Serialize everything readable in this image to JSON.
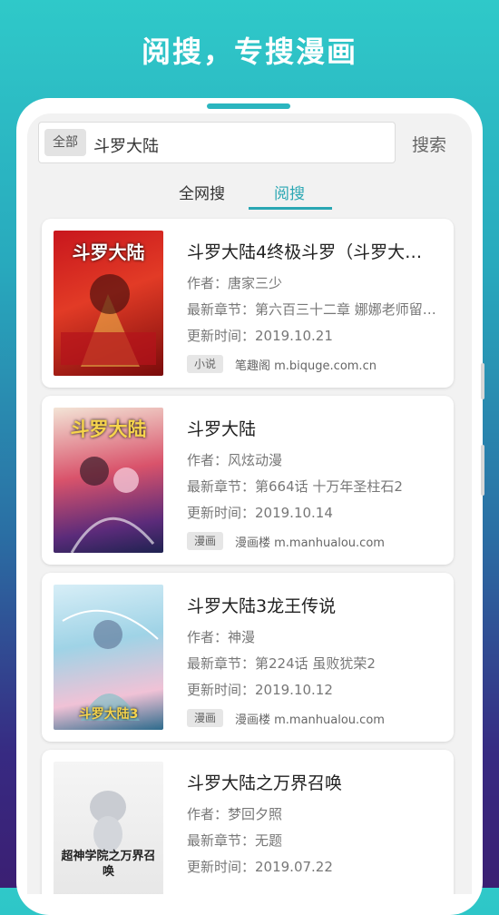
{
  "headline": "阅搜，专搜漫画",
  "search": {
    "scope_label": "全部",
    "query": "斗罗大陆",
    "button_label": "搜索"
  },
  "tabs": [
    {
      "label": "全网搜",
      "active": false
    },
    {
      "label": "阅搜",
      "active": true
    }
  ],
  "results": [
    {
      "title": "斗罗大陆4终极斗罗（斗罗大…",
      "author": "作者：唐家三少",
      "latest": "最新章节：第六百三十二章 娜娜老师留…",
      "updated": "更新时间：2019.10.21",
      "type": "小说",
      "source": "笔趣阁 m.biquge.com.cn",
      "cover_text": "斗罗大陆"
    },
    {
      "title": "斗罗大陆",
      "author": "作者：风炫动漫",
      "latest": "最新章节：第664话 十万年圣柱石2",
      "updated": "更新时间：2019.10.14",
      "type": "漫画",
      "source": "漫画楼 m.manhualou.com",
      "cover_text": "斗罗大陆"
    },
    {
      "title": "斗罗大陆3龙王传说",
      "author": "作者：神漫",
      "latest": "最新章节：第224话 虽败犹荣2",
      "updated": "更新时间：2019.10.12",
      "type": "漫画",
      "source": "漫画楼 m.manhualou.com",
      "cover_text": "斗罗大陆3"
    },
    {
      "title": "斗罗大陆之万界召唤",
      "author": "作者：梦回夕照",
      "latest": "最新章节：无题",
      "updated": "更新时间：2019.07.22",
      "type": "",
      "source": "",
      "cover_text": "超神学院之万界召唤"
    }
  ],
  "colors": {
    "accent": "#2aa7b3",
    "gradient_top": "#2fc9c9",
    "gradient_bottom": "#3b1f73"
  }
}
